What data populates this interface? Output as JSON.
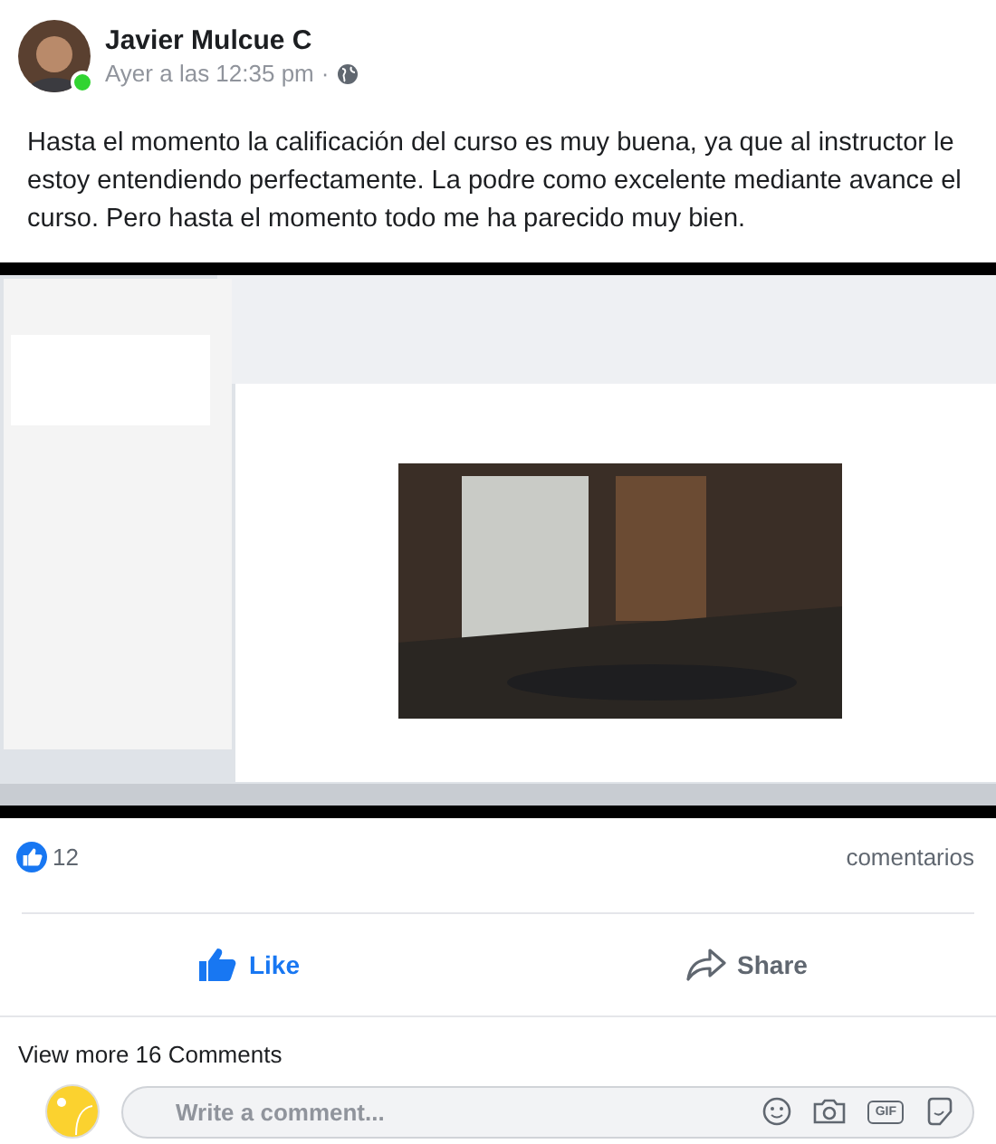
{
  "post": {
    "author": "Javier Mulcue C",
    "online": true,
    "time": "Ayer a las 12:35 pm",
    "separator": "·",
    "text": "Hasta el momento la calificación del curso es muy buena, ya que al instructor le estoy entendiendo perfectamente. La podre como excelente mediante avance el curso. Pero hasta el momento todo me ha parecido muy bien."
  },
  "reactions": {
    "count": "12",
    "comments_link": "comentarios"
  },
  "actions": [
    {
      "kind": "like",
      "label": "Like"
    },
    {
      "kind": "share",
      "label": "Share"
    }
  ],
  "view_more": "View more 16 Comments",
  "composer": {
    "placeholder": "Write a comment...",
    "gif": "GIF"
  }
}
